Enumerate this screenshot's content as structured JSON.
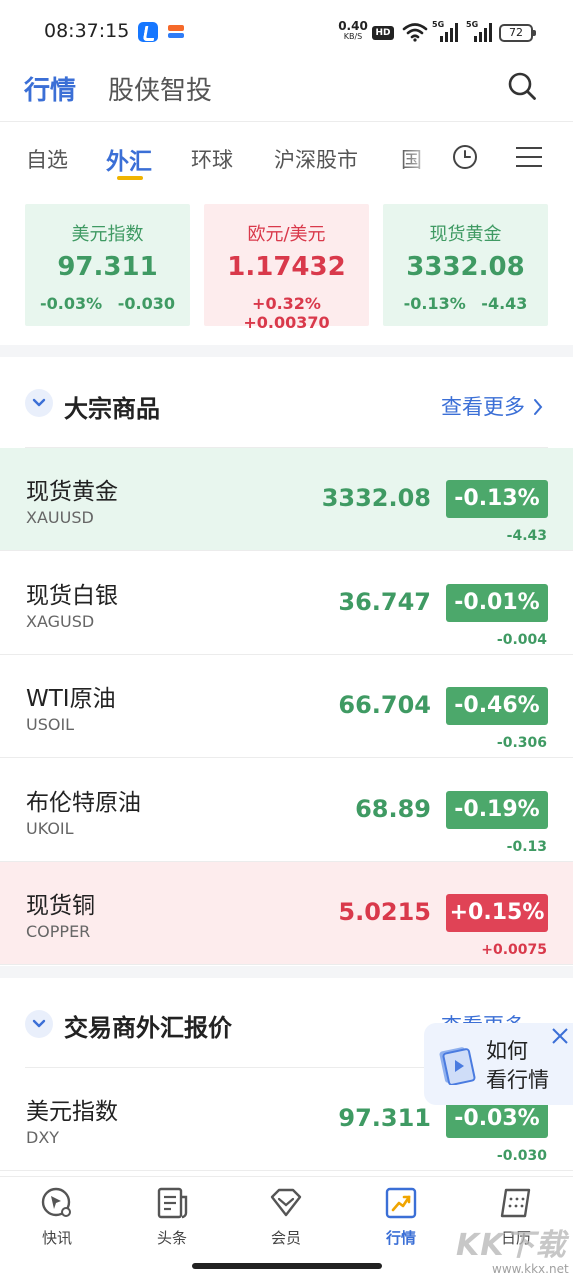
{
  "status_bar": {
    "time": "08:37:15",
    "net_speed": "0.40",
    "net_unit": "KB/S",
    "hd": "HD",
    "sim1": "5G",
    "sim2": "5G",
    "battery": "72"
  },
  "header": {
    "tabs": [
      "行情",
      "股侠智投"
    ],
    "active_tab": "行情"
  },
  "subtabs": {
    "items": [
      "自选",
      "外汇",
      "环球",
      "沪深股市",
      "国"
    ],
    "active": "外汇"
  },
  "index_cards": [
    {
      "name": "美元指数",
      "price": "97.311",
      "change": "-0.03% -0.030",
      "trend": "down"
    },
    {
      "name": "欧元/美元",
      "price": "1.17432",
      "change": "+0.32% +0.00370",
      "trend": "up"
    },
    {
      "name": "现货黄金",
      "price": "3332.08",
      "change": "-0.13% -4.43",
      "trend": "down"
    }
  ],
  "commodities": {
    "title": "大宗商品",
    "more": "查看更多",
    "rows": [
      {
        "name": "现货黄金",
        "code": "XAUUSD",
        "price": "3332.08",
        "pct": "-0.13%",
        "delta": "-4.43",
        "trend": "down",
        "highlight": "green"
      },
      {
        "name": "现货白银",
        "code": "XAGUSD",
        "price": "36.747",
        "pct": "-0.01%",
        "delta": "-0.004",
        "trend": "down",
        "highlight": "none"
      },
      {
        "name": "WTI原油",
        "code": "USOIL",
        "price": "66.704",
        "pct": "-0.46%",
        "delta": "-0.306",
        "trend": "down",
        "highlight": "none"
      },
      {
        "name": "布伦特原油",
        "code": "UKOIL",
        "price": "68.89",
        "pct": "-0.19%",
        "delta": "-0.13",
        "trend": "down",
        "highlight": "none"
      },
      {
        "name": "现货铜",
        "code": "COPPER",
        "price": "5.0215",
        "pct": "+0.15%",
        "delta": "+0.0075",
        "trend": "up",
        "highlight": "red"
      }
    ]
  },
  "broker_fx": {
    "title": "交易商外汇报价",
    "more": "查看更多",
    "rows": [
      {
        "name": "美元指数",
        "code": "DXY",
        "price": "97.311",
        "pct": "-0.03%",
        "delta": "-0.030",
        "trend": "down",
        "highlight": "none"
      }
    ]
  },
  "float_help": {
    "line1": "如何",
    "line2": "看行情"
  },
  "bottom_nav": {
    "items": [
      "快讯",
      "头条",
      "会员",
      "行情",
      "日历"
    ],
    "active": "行情"
  },
  "watermark": {
    "text": "KK下载",
    "url": "www.kkx.net"
  },
  "colors": {
    "accent": "#3b6fd6",
    "up": "#d9394b",
    "down": "#3f9a63",
    "up_bg": "#fdeced",
    "down_bg": "#e8f6ee"
  }
}
